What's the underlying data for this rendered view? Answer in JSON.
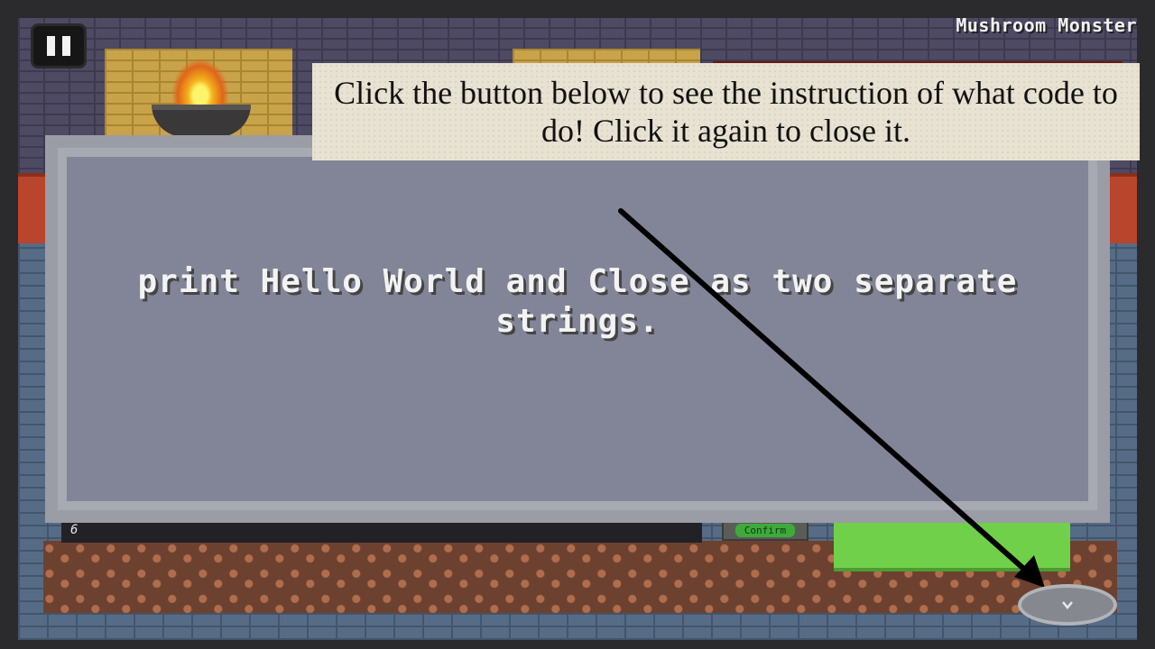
{
  "hud": {
    "boss_name": "Mushroom Monster"
  },
  "editor": {
    "line_number": "6",
    "confirm_label": "Confirm"
  },
  "dialog": {
    "instruction": "print Hello World and Close as two separate strings."
  },
  "tooltip": {
    "text": "Click the button below to see the instruction of what code to do! Click it again to close it."
  },
  "icons": {
    "pause": "pause-icon",
    "toggle": "chevron-down-icon"
  },
  "colors": {
    "dialog_bg": "#828597",
    "boss_health": "#b8321f",
    "player_bar": "#71d04a",
    "tooltip_bg": "#e8e2d3"
  }
}
